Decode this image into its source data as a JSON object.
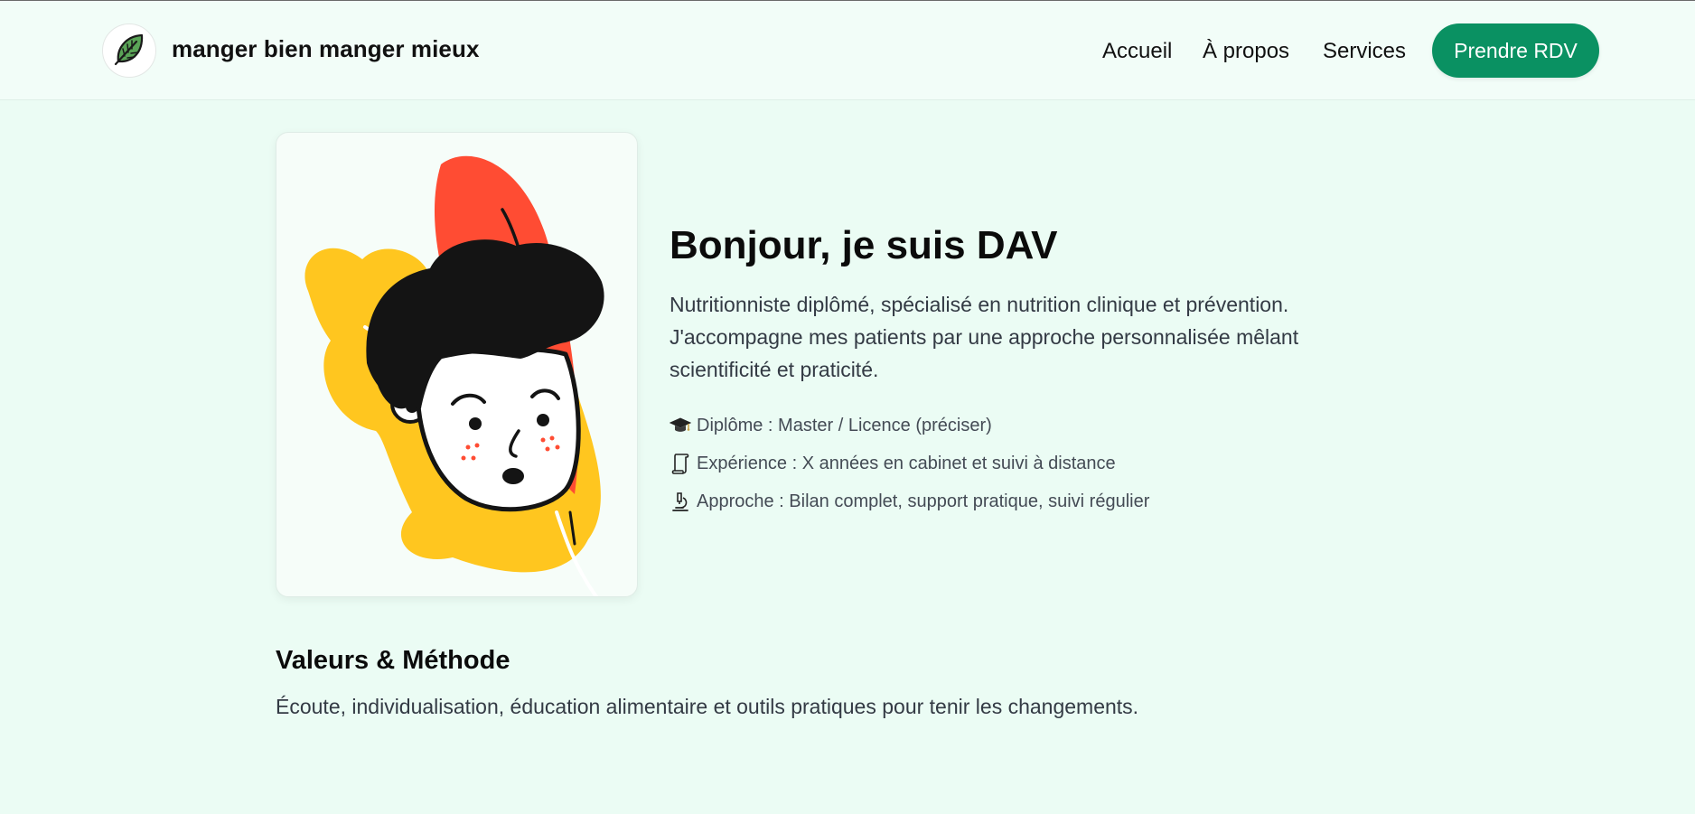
{
  "header": {
    "brand": "manger bien manger mieux",
    "logo_icon": "leaf-icon",
    "nav": [
      {
        "label": "Accueil"
      },
      {
        "label": "À propos"
      },
      {
        "label": "Services"
      }
    ],
    "cta_label": "Prendre RDV"
  },
  "profile": {
    "illustration": "cartoon-avatar-illustration",
    "title": "Bonjour, je suis DAV",
    "description": "Nutritionniste diplômé, spécialisé en nutrition clinique et prévention. J'accompagne mes patients par une approche personnalisée mêlant scientificité et praticité.",
    "facts": [
      {
        "icon": "graduation-cap-icon",
        "text": "Diplôme : Master / Licence (préciser)"
      },
      {
        "icon": "scroll-icon",
        "text": "Expérience : X années en cabinet et suivi à distance"
      },
      {
        "icon": "microscope-icon",
        "text": "Approche : Bilan complet, support pratique, suivi régulier"
      }
    ]
  },
  "values": {
    "title": "Valeurs & Méthode",
    "text": "Écoute, individualisation, éducation alimentaire et outils pratiques pour tenir les changements."
  },
  "colors": {
    "background": "#ebfcf4",
    "header_bg": "#f2fdf8",
    "accent": "#0a9162",
    "blob_yellow": "#ffc61f",
    "leaf_red": "#ff4c33",
    "hair": "#141414"
  }
}
